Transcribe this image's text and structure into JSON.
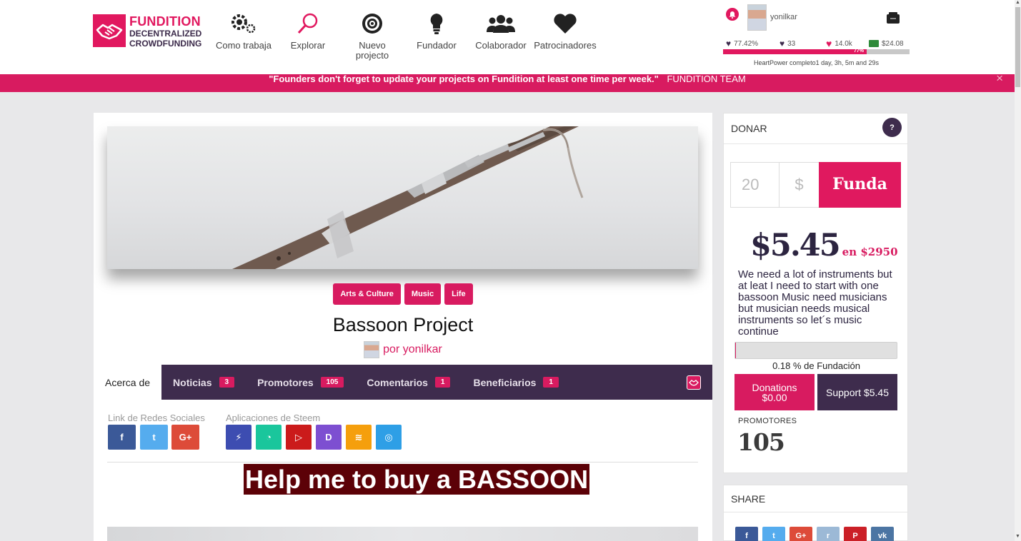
{
  "brand": {
    "line1": "FUNDITION",
    "line2": "DECENTRALIZED",
    "line3": "CROWDFUNDING",
    "color": "#e1185f"
  },
  "nav": [
    {
      "label": "Como trabaja",
      "icon": "gears-icon"
    },
    {
      "label": "Explorar",
      "icon": "search-icon"
    },
    {
      "label": "Nuevo projecto",
      "icon": "target-icon"
    },
    {
      "label": "Fundador",
      "icon": "lightbulb-icon"
    },
    {
      "label": "Colaborador",
      "icon": "users-icon"
    },
    {
      "label": "Patrocinadores",
      "icon": "heart-icon"
    }
  ],
  "user": {
    "name": "yonilkar",
    "stats": [
      {
        "icon": "heart-power-icon",
        "value": "77.42%"
      },
      {
        "icon": "heart-small-icon",
        "value": "33"
      },
      {
        "icon": "heart-icon",
        "value": "14.0k"
      },
      {
        "icon": "money-icon",
        "value": "$24.08"
      }
    ],
    "power_percent": 77,
    "power_label": "77%",
    "heartpower": "HeartPower completo1 day, 3h, 5m and 29s"
  },
  "banner": {
    "message": "\"Founders don't forget to update your projects on Fundition at least one time per week.\"",
    "team": "FUNDITION TEAM",
    "close": "×"
  },
  "project": {
    "tags": [
      "Arts & Culture",
      "Music",
      "Life"
    ],
    "title": "Bassoon Project",
    "author": "por yonilkar",
    "headline": "Help me to buy a BASSOON"
  },
  "tabs": [
    {
      "label": "Acerca de",
      "count": null
    },
    {
      "label": "Noticias",
      "count": "3"
    },
    {
      "label": "Promotores",
      "count": "105"
    },
    {
      "label": "Comentarios",
      "count": "1"
    },
    {
      "label": "Beneficiarios",
      "count": "1"
    }
  ],
  "social": {
    "redes_label": "Link de Redes Sociales",
    "steem_label": "Aplicaciones de Steem",
    "redes": [
      {
        "icon": "facebook-icon",
        "glyph": "f",
        "color": "#3b5998"
      },
      {
        "icon": "twitter-icon",
        "glyph": "t",
        "color": "#55acee"
      },
      {
        "icon": "google-plus-icon",
        "glyph": "G+",
        "color": "#dd4b39"
      }
    ],
    "steem": [
      {
        "icon": "steemit-icon",
        "glyph": "⚡",
        "color": "#3d4db1"
      },
      {
        "icon": "busy-icon",
        "glyph": "◔",
        "color": "#1ac69c"
      },
      {
        "icon": "dtube-icon",
        "glyph": "▷",
        "color": "#cb1b1b"
      },
      {
        "icon": "dlive-icon",
        "glyph": "D",
        "color": "#7d4fd1"
      },
      {
        "icon": "dsound-icon",
        "glyph": "≋",
        "color": "#f59f0c"
      },
      {
        "icon": "utopian-icon",
        "glyph": "◎",
        "color": "#2e9fe6"
      }
    ]
  },
  "donate": {
    "title": "DONAR",
    "help": "?",
    "amount": "20",
    "currency": "$",
    "button": "Funda",
    "raised": "$5.45",
    "goal": "en $2950",
    "description": "We need a lot of instruments but at leat I need to start with one bassoon Music need musicians but musician needs musical instruments so let´s music continue",
    "funded_percent": 0.18,
    "funded_label": "0.18 % de Fundación",
    "donations_line1": "Donations",
    "donations_line2": "$0.00",
    "support": "Support $5.45",
    "promoters_label": "PROMOTORES",
    "promoters": "105"
  },
  "share": {
    "title": "SHARE",
    "buttons": [
      {
        "icon": "facebook-icon",
        "glyph": "f",
        "color": "#3b5998"
      },
      {
        "icon": "twitter-icon",
        "glyph": "t",
        "color": "#55acee"
      },
      {
        "icon": "google-plus-icon",
        "glyph": "G+",
        "color": "#dd4b39"
      },
      {
        "icon": "reddit-icon",
        "glyph": "r",
        "color": "#9cb9d6"
      },
      {
        "icon": "pinterest-icon",
        "glyph": "P",
        "color": "#cb2027"
      },
      {
        "icon": "vk-icon",
        "glyph": "vk",
        "color": "#4c75a3"
      }
    ]
  },
  "colors": {
    "accent": "#d81b60",
    "dark": "#3e2c4d",
    "headline_bg": "#5c0107"
  }
}
